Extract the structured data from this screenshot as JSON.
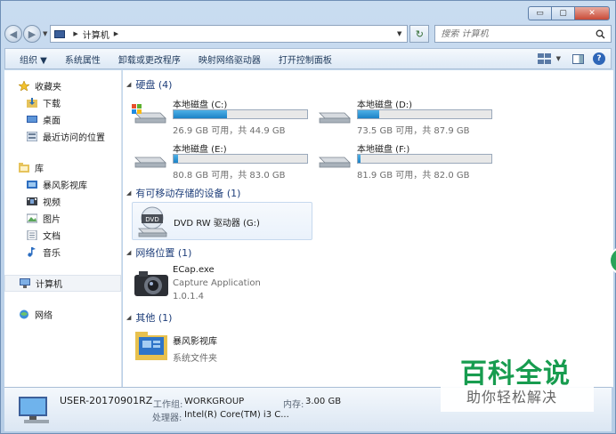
{
  "window": {
    "caption_buttons": {
      "minimize": "▭",
      "maximize": "▢",
      "close": "✕"
    }
  },
  "address_bar": {
    "path": [
      "计算机"
    ],
    "search_placeholder": "搜索 计算机"
  },
  "toolbar": {
    "items": [
      "组织 ▼",
      "系统属性",
      "卸载或更改程序",
      "映射网络驱动器",
      "打开控制面板"
    ]
  },
  "sidebar": {
    "favorites": {
      "label": "收藏夹",
      "items": [
        "下载",
        "桌面",
        "最近访问的位置"
      ]
    },
    "libraries": {
      "label": "库",
      "items": [
        "暴风影视库",
        "视频",
        "图片",
        "文档",
        "音乐"
      ]
    },
    "computer": {
      "label": "计算机"
    },
    "network": {
      "label": "网络"
    }
  },
  "groups": {
    "hard_disks": {
      "header": "硬盘 (4)",
      "drives": [
        {
          "name": "本地磁盘 (C:)",
          "info": "26.9 GB 可用，共 44.9 GB",
          "used_fraction": 0.4
        },
        {
          "name": "本地磁盘 (D:)",
          "info": "73.5 GB 可用，共 87.9 GB",
          "used_fraction": 0.16
        },
        {
          "name": "本地磁盘 (E:)",
          "info": "80.8 GB 可用，共 83.0 GB",
          "used_fraction": 0.03
        },
        {
          "name": "本地磁盘 (F:)",
          "info": "81.9 GB 可用，共 82.0 GB",
          "used_fraction": 0.0
        }
      ]
    },
    "removable": {
      "header": "有可移动存储的设备 (1)",
      "device": {
        "name": "DVD RW 驱动器 (G:)",
        "icon_label": "DVD"
      }
    },
    "network_location": {
      "header": "网络位置 (1)",
      "item": {
        "name": "ECap.exe",
        "desc": "Capture Application",
        "version": "1.0.1.4"
      }
    },
    "other": {
      "header": "其他 (1)",
      "item": {
        "name": "暴风影视库",
        "desc": "系统文件夹"
      }
    }
  },
  "details": {
    "computer_name": "USER-20170901RZ",
    "workgroup_label": "工作组:",
    "workgroup_value": "WORKGROUP",
    "memory_label": "内存:",
    "memory_value": "3.00 GB",
    "processor_label": "处理器:",
    "processor_value": "Intel(R) Core(TM) i3 C..."
  },
  "watermark": {
    "logo": "百科全说",
    "slogan": "助你轻松解决"
  },
  "colors": {
    "accent": "#1e3e7a",
    "drive_bar": "#1c82c6",
    "watermark_green": "#179c4f"
  }
}
